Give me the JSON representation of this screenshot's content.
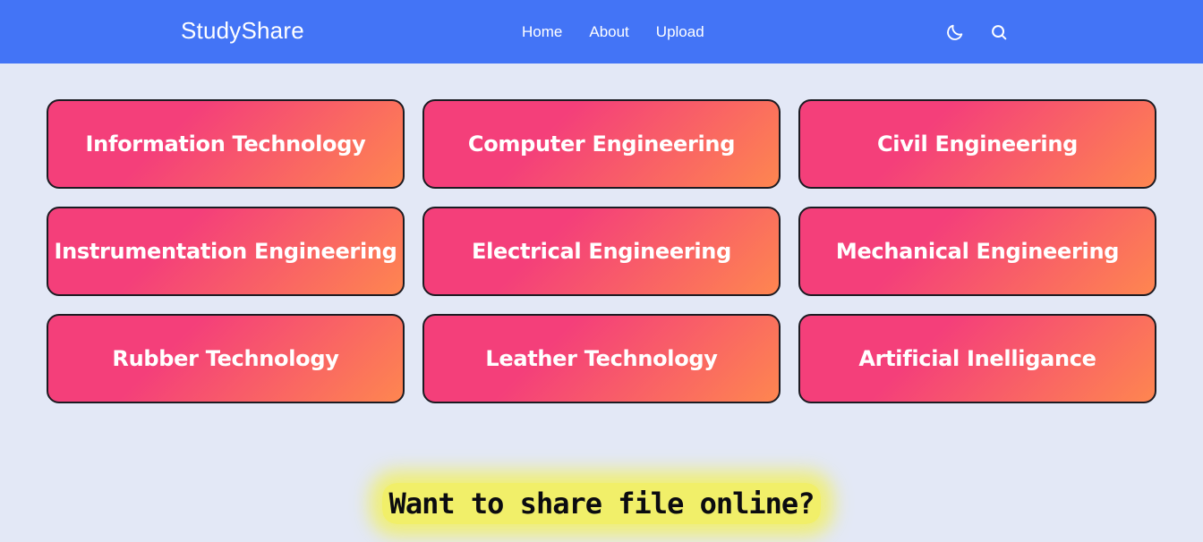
{
  "navbar": {
    "brand": "StudyShare",
    "links": [
      "Home",
      "About",
      "Upload"
    ],
    "icons": {
      "theme_toggle": "moon-icon",
      "search": "search-icon"
    }
  },
  "departments": [
    "Information Technology",
    "Computer Engineering",
    "Civil Engineering",
    "Instrumentation Engineering",
    "Electrical Engineering",
    "Mechanical Engineering",
    "Rubber Technology",
    "Leather Technology",
    "Artificial Inelligance"
  ],
  "cta": {
    "text": "Want to share file online?"
  },
  "colors": {
    "navbar": "#4374f6",
    "background": "#e3e8f6",
    "card_gradient_start": "#f43f7a",
    "card_gradient_end": "#fe8650",
    "highlight": "#f3f050"
  }
}
